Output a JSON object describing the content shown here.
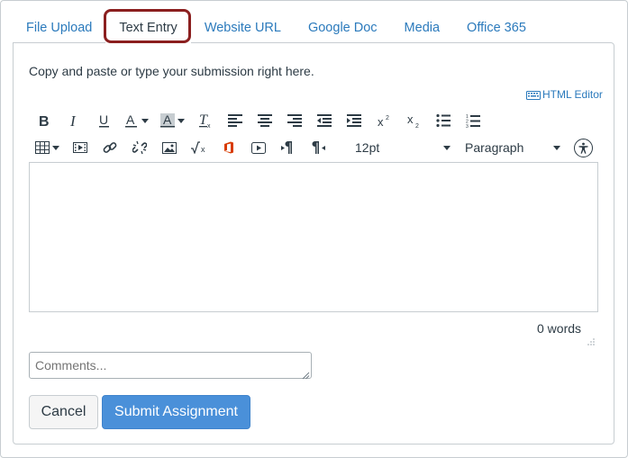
{
  "tabs": [
    {
      "label": "File Upload",
      "active": false
    },
    {
      "label": "Text Entry",
      "active": true
    },
    {
      "label": "Website URL",
      "active": false
    },
    {
      "label": "Google Doc",
      "active": false
    },
    {
      "label": "Media",
      "active": false
    },
    {
      "label": "Office 365",
      "active": false
    }
  ],
  "instructions": "Copy and paste or type your submission right here.",
  "html_editor_label": "HTML Editor",
  "toolbar": {
    "row1_icons": [
      "bold-icon",
      "italic-icon",
      "underline-icon",
      "text-color-icon",
      "background-color-icon",
      "clear-formatting-icon",
      "align-left-icon",
      "align-center-icon",
      "align-right-icon",
      "outdent-icon",
      "indent-icon",
      "superscript-icon",
      "subscript-icon",
      "bulleted-list-icon",
      "numbered-list-icon"
    ],
    "row2_icons": [
      "table-icon",
      "media-embed-icon",
      "link-icon",
      "unlink-icon",
      "image-icon",
      "equation-icon",
      "office-icon",
      "video-icon",
      "ltr-paragraph-icon",
      "rtl-paragraph-icon"
    ],
    "font_size": "12pt",
    "block_format": "Paragraph",
    "accessibility_icon": "accessibility-checker-icon"
  },
  "word_count": "0 words",
  "comments": {
    "placeholder": "Comments...",
    "value": ""
  },
  "buttons": {
    "cancel": "Cancel",
    "submit": "Submit Assignment"
  },
  "colors": {
    "link": "#2b7abc",
    "text": "#2d3b45",
    "submit_bg": "#4a90d9",
    "tab_highlight": "#8b1f1f"
  }
}
